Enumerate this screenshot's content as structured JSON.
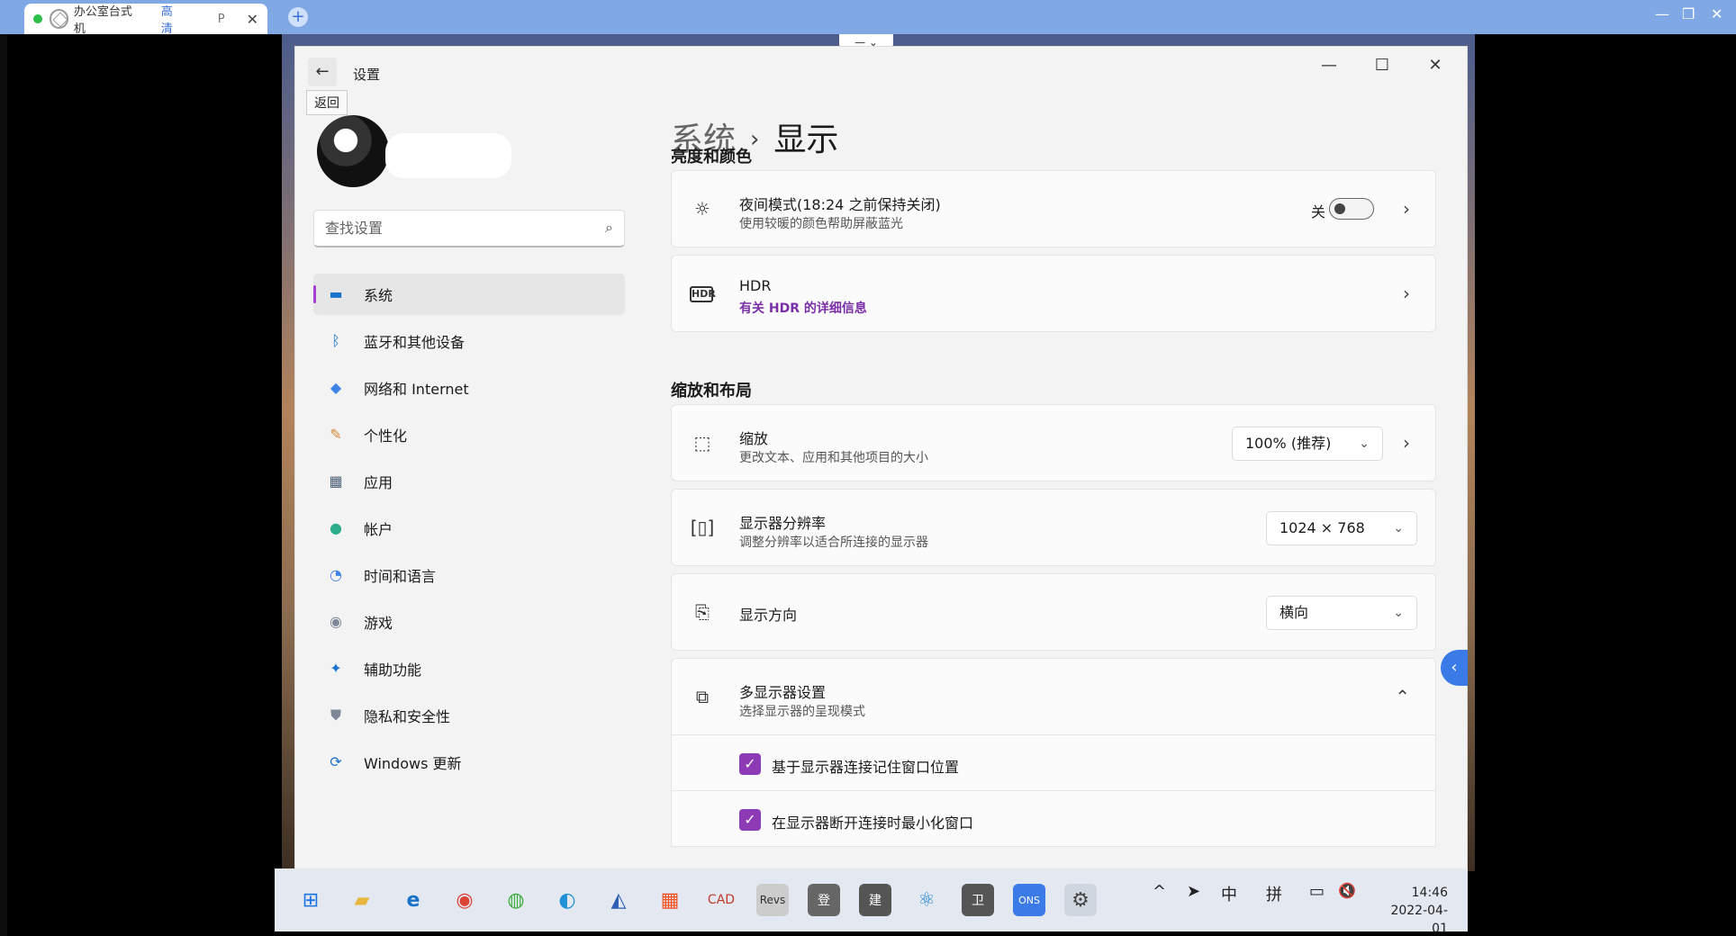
{
  "client": {
    "tab_name": "办公室台式机",
    "tab_quality": "高清",
    "tab_p": "P",
    "tab_close": "✕",
    "new_tab": "+",
    "win_min": "—",
    "win_restore": "❐",
    "win_close": "✕",
    "float_ctrl": "— ⌄"
  },
  "settings": {
    "app_title": "设置",
    "back_icon": "←",
    "back_tooltip": "返回",
    "win_min": "—",
    "win_max": "☐",
    "win_close": "✕",
    "search_placeholder": "查找设置",
    "search_icon": "⌕",
    "nav": [
      {
        "label": "系统",
        "icon": "▬",
        "color": "#1a73c9"
      },
      {
        "label": "蓝牙和其他设备",
        "icon": "ᛒ",
        "color": "#1a73c9"
      },
      {
        "label": "网络和 Internet",
        "icon": "◆",
        "color": "#3f83e6"
      },
      {
        "label": "个性化",
        "icon": "✎",
        "color": "#d38a3a"
      },
      {
        "label": "应用",
        "icon": "▦",
        "color": "#50607a"
      },
      {
        "label": "帐户",
        "icon": "●",
        "color": "#2cae8d"
      },
      {
        "label": "时间和语言",
        "icon": "◔",
        "color": "#3f83e6"
      },
      {
        "label": "游戏",
        "icon": "◉",
        "color": "#7d8796"
      },
      {
        "label": "辅助功能",
        "icon": "✦",
        "color": "#1a73c9"
      },
      {
        "label": "隐私和安全性",
        "icon": "⛊",
        "color": "#7d8796"
      },
      {
        "label": "Windows 更新",
        "icon": "⟳",
        "color": "#1a73c9"
      }
    ],
    "breadcrumb_parent": "系统",
    "breadcrumb_sep": "›",
    "breadcrumb_current": "显示",
    "section_brightness": "亮度和颜色",
    "night_mode_title": "夜间模式(18:24 之前保持关闭)",
    "night_mode_sub": "使用较暖的颜色帮助屏蔽蓝光",
    "night_mode_state": "关",
    "night_mode_on": false,
    "hdr_title": "HDR",
    "hdr_link": "有关 HDR 的详细信息",
    "section_scale": "缩放和布局",
    "scale_title": "缩放",
    "scale_sub": "更改文本、应用和其他项目的大小",
    "scale_value": "100% (推荐)",
    "resolution_title": "显示器分辨率",
    "resolution_sub": "调整分辨率以适合所连接的显示器",
    "resolution_value": "1024 × 768",
    "orientation_title": "显示方向",
    "orientation_value": "横向",
    "multi_title": "多显示器设置",
    "multi_sub": "选择显示器的呈现模式",
    "check1_label": "基于显示器连接记住窗口位置",
    "check1_checked": true,
    "check2_label": "在显示器断开连接时最小化窗口",
    "check2_checked": true,
    "chevron_right": "›",
    "chevron_up": "⌃",
    "dropdown_arrow": "⌄",
    "checkmark": "✓",
    "side_handle": "‹"
  },
  "taskbar": {
    "tray_icons": [
      "^",
      "➤",
      "中",
      "拼",
      "▭",
      "🔇"
    ],
    "time": "14:46",
    "date": "2022-04-01"
  }
}
